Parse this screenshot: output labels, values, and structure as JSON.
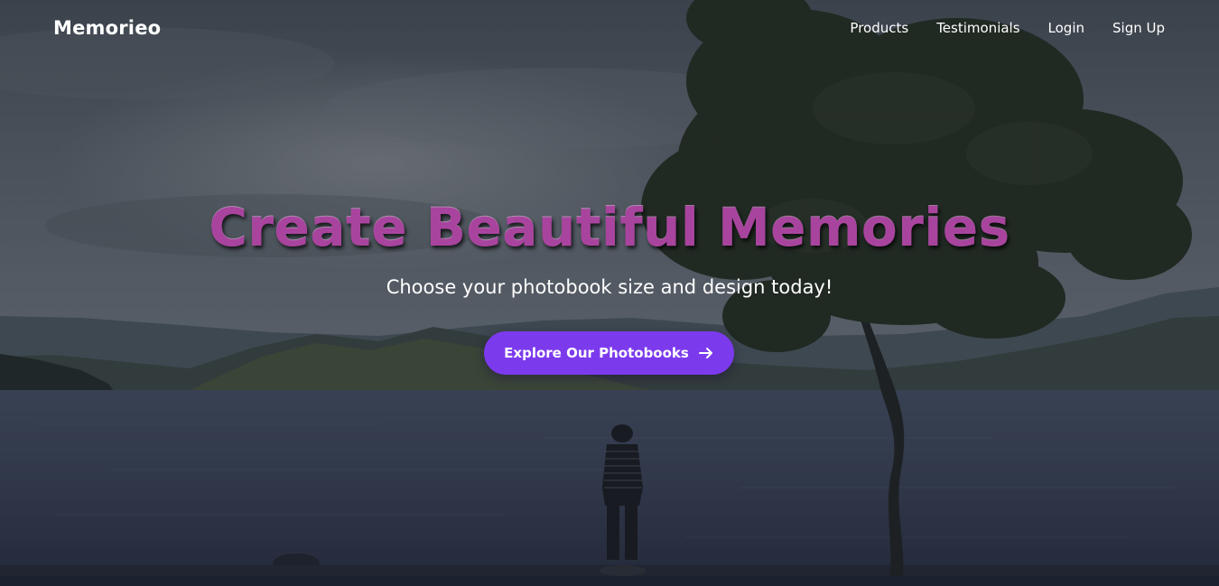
{
  "nav": {
    "brand": "Memorieo",
    "links": [
      "Products",
      "Testimonials",
      "Login",
      "Sign Up"
    ]
  },
  "hero": {
    "title": "Create Beautiful Memories",
    "subtitle": "Choose your photobook size and design today!",
    "cta_label": "Explore Our Photobooks",
    "cta_icon": "arrow-right-icon"
  },
  "colors": {
    "accent": "#7c3aed",
    "title": "#a8449e",
    "text": "#ffffff"
  }
}
